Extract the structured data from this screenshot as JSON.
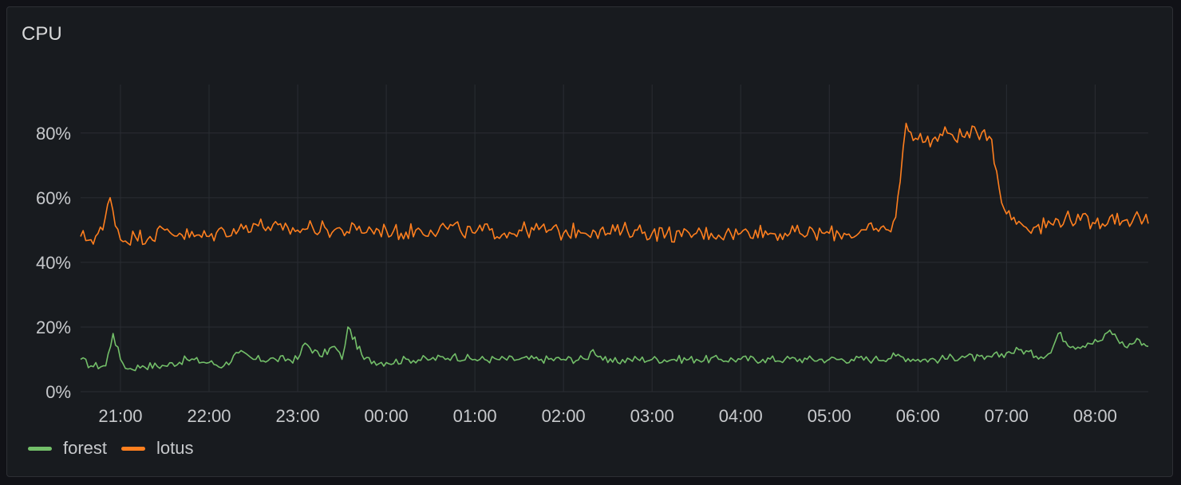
{
  "panel": {
    "title": "CPU"
  },
  "chart_data": {
    "type": "line",
    "title": "CPU",
    "xlabel": "",
    "ylabel": "",
    "x_range": [
      "20:33",
      "08:36"
    ],
    "x_ticks": [
      "21:00",
      "22:00",
      "23:00",
      "00:00",
      "01:00",
      "02:00",
      "03:00",
      "04:00",
      "05:00",
      "06:00",
      "07:00",
      "08:00"
    ],
    "ylim": [
      0,
      95
    ],
    "y_ticks": [
      "0%",
      "20%",
      "40%",
      "60%",
      "80%"
    ],
    "y_tick_values": [
      0,
      20,
      40,
      60,
      80
    ],
    "grid": true,
    "legend_position": "bottom-left",
    "series": [
      {
        "name": "forest",
        "color": "#73bf69",
        "points": [
          [
            "20:33",
            10
          ],
          [
            "20:40",
            8
          ],
          [
            "20:50",
            8
          ],
          [
            "20:55",
            18
          ],
          [
            "21:00",
            10
          ],
          [
            "21:05",
            7
          ],
          [
            "21:15",
            8
          ],
          [
            "21:30",
            8
          ],
          [
            "21:45",
            10
          ],
          [
            "22:00",
            9
          ],
          [
            "22:10",
            8
          ],
          [
            "22:20",
            12
          ],
          [
            "22:30",
            10
          ],
          [
            "22:45",
            10
          ],
          [
            "23:00",
            10
          ],
          [
            "23:05",
            15
          ],
          [
            "23:15",
            11
          ],
          [
            "23:25",
            14
          ],
          [
            "23:30",
            10
          ],
          [
            "23:34",
            20
          ],
          [
            "23:45",
            10
          ],
          [
            "00:00",
            9
          ],
          [
            "00:15",
            10
          ],
          [
            "00:30",
            10
          ],
          [
            "00:45",
            11
          ],
          [
            "01:00",
            10
          ],
          [
            "01:15",
            10
          ],
          [
            "01:30",
            10
          ],
          [
            "01:45",
            10
          ],
          [
            "02:00",
            10
          ],
          [
            "02:15",
            10
          ],
          [
            "02:20",
            13
          ],
          [
            "02:30",
            9
          ],
          [
            "02:45",
            10
          ],
          [
            "03:00",
            10
          ],
          [
            "03:15",
            10
          ],
          [
            "03:30",
            10
          ],
          [
            "03:45",
            10
          ],
          [
            "04:00",
            10
          ],
          [
            "04:15",
            10
          ],
          [
            "04:30",
            10
          ],
          [
            "04:45",
            10
          ],
          [
            "05:00",
            10
          ],
          [
            "05:15",
            10
          ],
          [
            "05:30",
            10
          ],
          [
            "05:45",
            11
          ],
          [
            "06:00",
            10
          ],
          [
            "06:15",
            10
          ],
          [
            "06:30",
            11
          ],
          [
            "06:45",
            10
          ],
          [
            "07:00",
            12
          ],
          [
            "07:10",
            13
          ],
          [
            "07:20",
            11
          ],
          [
            "07:30",
            12
          ],
          [
            "07:35",
            18
          ],
          [
            "07:45",
            14
          ],
          [
            "07:55",
            15
          ],
          [
            "08:05",
            16
          ],
          [
            "08:10",
            19
          ],
          [
            "08:20",
            14
          ],
          [
            "08:30",
            16
          ],
          [
            "08:36",
            14
          ]
        ]
      },
      {
        "name": "lotus",
        "color": "#ff7f1f",
        "points": [
          [
            "20:33",
            48
          ],
          [
            "20:40",
            47
          ],
          [
            "20:48",
            50
          ],
          [
            "20:53",
            60
          ],
          [
            "21:00",
            47
          ],
          [
            "21:10",
            48
          ],
          [
            "21:20",
            48
          ],
          [
            "21:30",
            50
          ],
          [
            "21:40",
            49
          ],
          [
            "21:50",
            48
          ],
          [
            "22:00",
            48
          ],
          [
            "22:10",
            50
          ],
          [
            "22:20",
            50
          ],
          [
            "22:30",
            52
          ],
          [
            "22:40",
            51
          ],
          [
            "22:50",
            50
          ],
          [
            "23:00",
            50
          ],
          [
            "23:10",
            51
          ],
          [
            "23:20",
            50
          ],
          [
            "23:30",
            50
          ],
          [
            "23:40",
            50
          ],
          [
            "23:50",
            50
          ],
          [
            "00:00",
            50
          ],
          [
            "00:10",
            49
          ],
          [
            "00:20",
            50
          ],
          [
            "00:30",
            50
          ],
          [
            "00:40",
            51
          ],
          [
            "00:50",
            50
          ],
          [
            "01:00",
            49
          ],
          [
            "01:10",
            50
          ],
          [
            "01:20",
            49
          ],
          [
            "01:30",
            50
          ],
          [
            "01:40",
            50
          ],
          [
            "01:50",
            50
          ],
          [
            "02:00",
            49
          ],
          [
            "02:10",
            50
          ],
          [
            "02:20",
            50
          ],
          [
            "02:30",
            49
          ],
          [
            "02:40",
            50
          ],
          [
            "02:50",
            50
          ],
          [
            "03:00",
            49
          ],
          [
            "03:10",
            49
          ],
          [
            "03:20",
            48
          ],
          [
            "03:30",
            49
          ],
          [
            "03:40",
            49
          ],
          [
            "03:50",
            49
          ],
          [
            "04:00",
            49
          ],
          [
            "04:10",
            50
          ],
          [
            "04:20",
            49
          ],
          [
            "04:30",
            49
          ],
          [
            "04:40",
            49
          ],
          [
            "04:50",
            49
          ],
          [
            "05:00",
            49
          ],
          [
            "05:10",
            49
          ],
          [
            "05:20",
            49
          ],
          [
            "05:30",
            50
          ],
          [
            "05:40",
            50
          ],
          [
            "05:45",
            54
          ],
          [
            "05:48",
            65
          ],
          [
            "05:52",
            83
          ],
          [
            "06:00",
            78
          ],
          [
            "06:10",
            78
          ],
          [
            "06:20",
            80
          ],
          [
            "06:30",
            79
          ],
          [
            "06:40",
            80
          ],
          [
            "06:45",
            81
          ],
          [
            "06:50",
            78
          ],
          [
            "06:55",
            63
          ],
          [
            "07:00",
            55
          ],
          [
            "07:10",
            52
          ],
          [
            "07:20",
            51
          ],
          [
            "07:30",
            52
          ],
          [
            "07:40",
            54
          ],
          [
            "07:50",
            53
          ],
          [
            "08:00",
            52
          ],
          [
            "08:10",
            54
          ],
          [
            "08:20",
            53
          ],
          [
            "08:30",
            54
          ],
          [
            "08:36",
            52
          ]
        ]
      }
    ]
  }
}
